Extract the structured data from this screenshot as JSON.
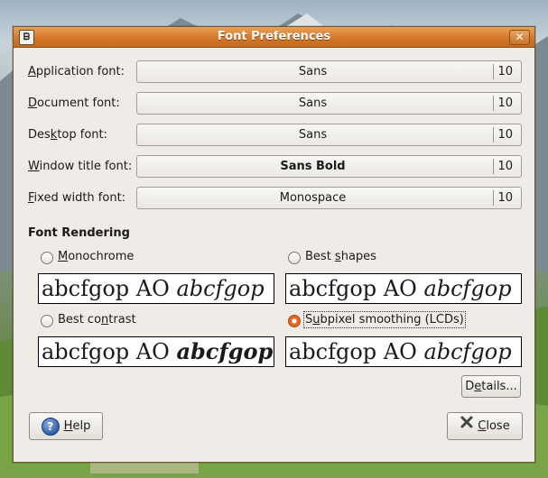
{
  "window": {
    "title": "Font Preferences",
    "icon": "font-app-icon",
    "close_glyph": "✕"
  },
  "fonts": [
    {
      "label_pre": "",
      "label_key": "A",
      "label_post": "pplication font:",
      "font": "Sans",
      "size": "10",
      "bold": false
    },
    {
      "label_pre": "",
      "label_key": "D",
      "label_post": "ocument font:",
      "font": "Sans",
      "size": "10",
      "bold": false
    },
    {
      "label_pre": "Des",
      "label_key": "k",
      "label_post": "top font:",
      "font": "Sans",
      "size": "10",
      "bold": false
    },
    {
      "label_pre": "",
      "label_key": "W",
      "label_post": "indow title font:",
      "font": "Sans Bold",
      "size": "10",
      "bold": true
    },
    {
      "label_pre": "",
      "label_key": "F",
      "label_post": "ixed width font:",
      "font": "Monospace",
      "size": "10",
      "bold": false
    }
  ],
  "rendering": {
    "heading": "Font Rendering",
    "options": [
      {
        "label_pre": "",
        "label_key": "M",
        "label_post": "onochrome",
        "selected": false
      },
      {
        "label_pre": "Best ",
        "label_key": "s",
        "label_post": "hapes",
        "selected": false
      },
      {
        "label_pre": "Best co",
        "label_key": "n",
        "label_post": "trast",
        "selected": false
      },
      {
        "label_pre": "S",
        "label_key": "u",
        "label_post": "bpixel smoothing (LCDs)",
        "selected": true
      }
    ],
    "sample_regular": "abcfgop AO ",
    "sample_italic": "abcfgop"
  },
  "buttons": {
    "details_pre": "D",
    "details_key": "e",
    "details_post": "tails...",
    "help_key": "H",
    "help_post": "elp",
    "help_icon": "?",
    "close_key": "C",
    "close_post": "lose"
  },
  "colors": {
    "titlebar": "#d4782a",
    "selected_radio": "#e8702a",
    "window_bg": "#efebe7"
  }
}
